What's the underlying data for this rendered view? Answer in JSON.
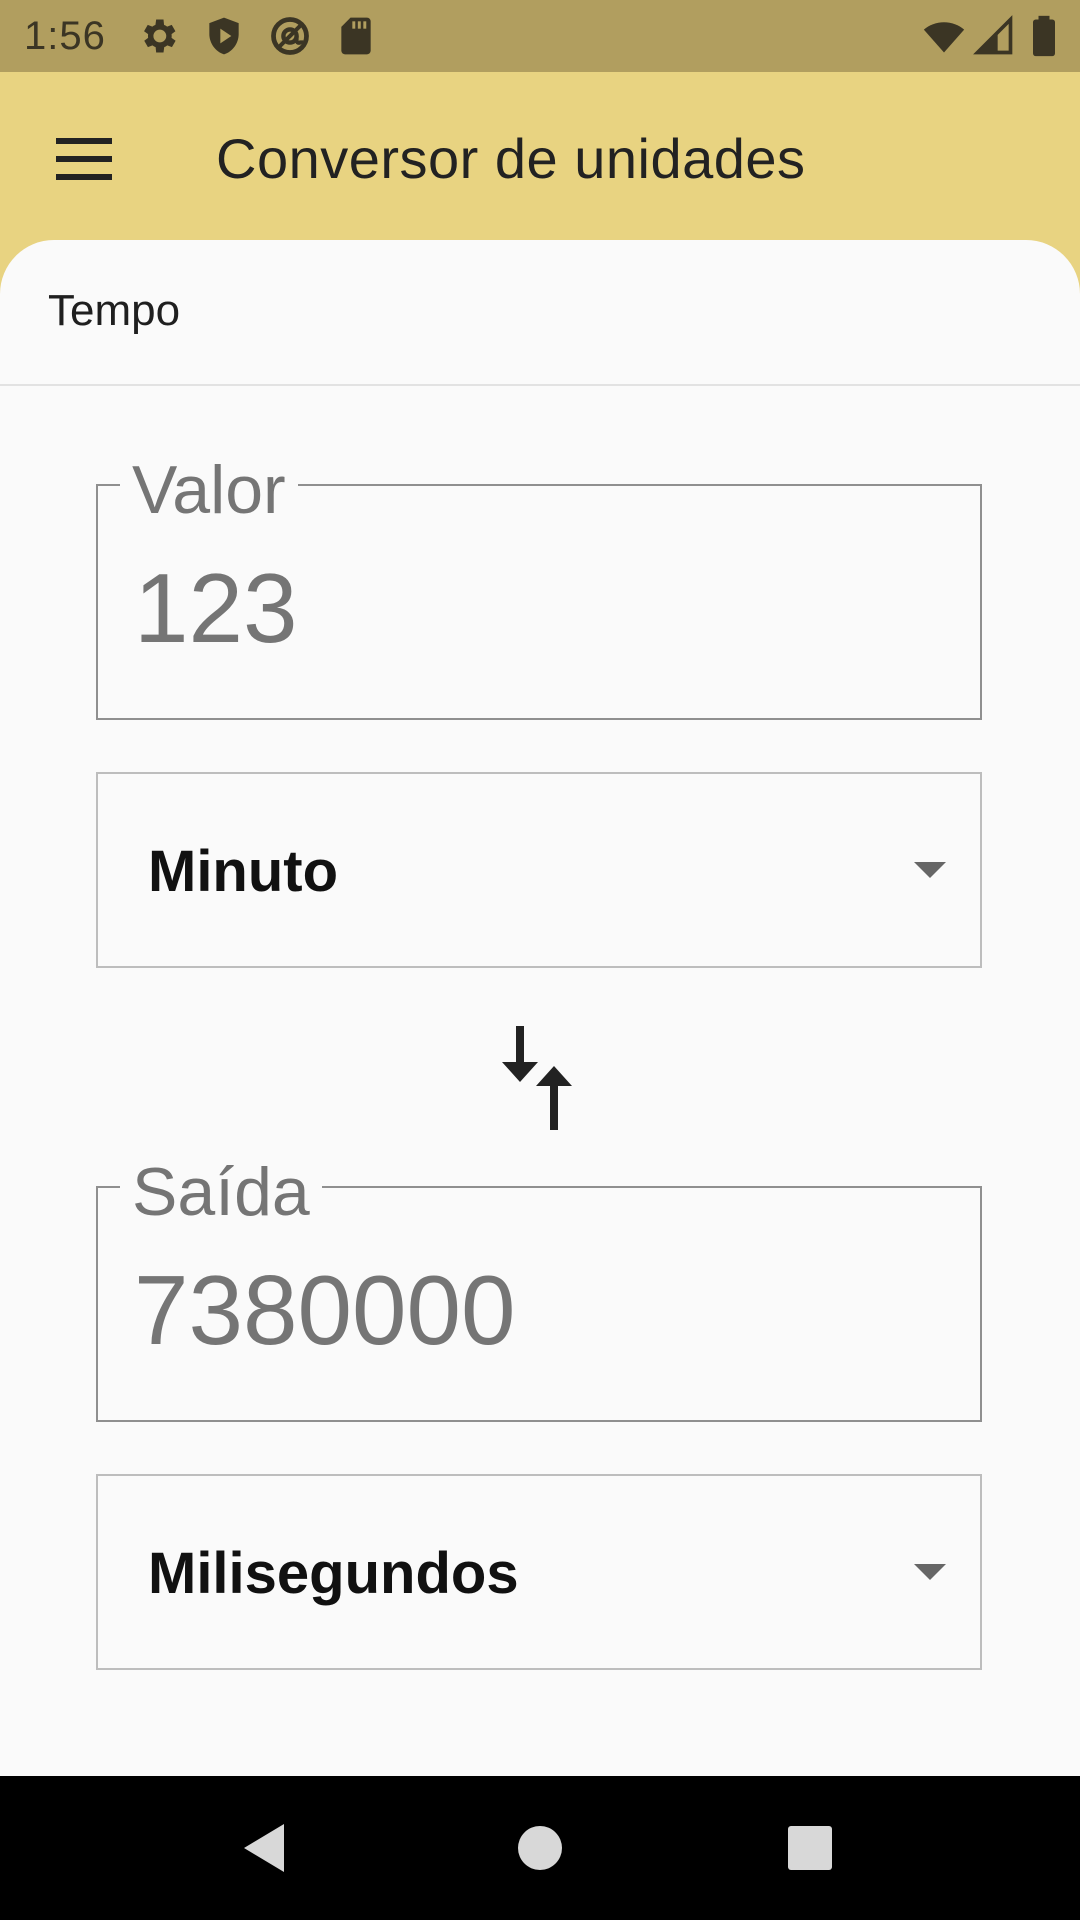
{
  "status_bar": {
    "time": "1:56",
    "left_icons": [
      "gear-icon",
      "shield-play-icon",
      "at-icon",
      "sd-card-icon"
    ],
    "right_icons": [
      "wifi-icon",
      "cellular-signal-icon",
      "battery-icon"
    ]
  },
  "app_bar": {
    "title": "Conversor de unidades",
    "menu_icon": "hamburger-menu-icon"
  },
  "category": {
    "label": "Tempo"
  },
  "input_field": {
    "label": "Valor",
    "value": "123"
  },
  "from_unit": {
    "selected": "Minuto"
  },
  "swap": {
    "icon": "swap-vertical-icon"
  },
  "output_field": {
    "label": "Saída",
    "value": "7380000"
  },
  "to_unit": {
    "selected": "Milisegundos"
  },
  "nav_bar": {
    "icons": [
      "back-icon",
      "home-icon",
      "recents-icon"
    ]
  },
  "colors": {
    "status_bar": "#b19e5f",
    "app_bar": "#e8d381",
    "sheet": "#fafafa",
    "nav_bar": "#000000"
  }
}
